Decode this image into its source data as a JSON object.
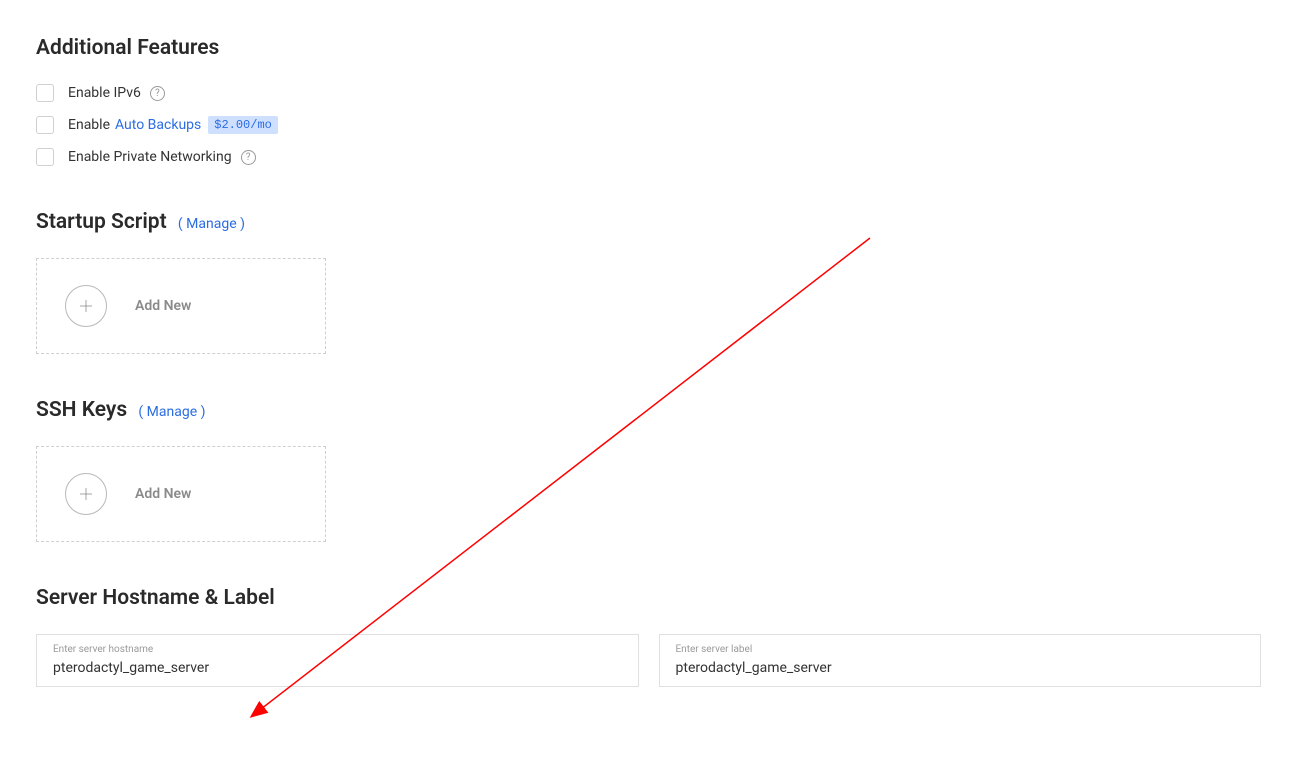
{
  "sections": {
    "additional": {
      "title": "Additional Features",
      "rows": [
        {
          "label_prefix": "Enable IPv6",
          "link": "",
          "badge": "",
          "help": true
        },
        {
          "label_prefix": "Enable ",
          "link": "Auto Backups",
          "badge": "$2.00/mo",
          "help": false
        },
        {
          "label_prefix": "Enable Private Networking",
          "link": "",
          "badge": "",
          "help": true
        }
      ]
    },
    "startup": {
      "title": "Startup Script",
      "manage": "( Manage )",
      "add_new": "Add New"
    },
    "ssh": {
      "title": "SSH Keys",
      "manage": "( Manage )",
      "add_new": "Add New"
    },
    "hostname": {
      "title": "Server Hostname & Label",
      "hostname_label": "Enter server hostname",
      "hostname_value": "pterodactyl_game_server",
      "label_label": "Enter server label",
      "label_value": "pterodactyl_game_server"
    }
  }
}
